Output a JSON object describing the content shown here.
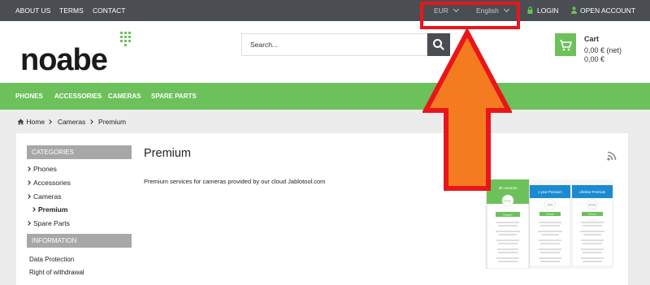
{
  "topbar": {
    "links": [
      "ABOUT US",
      "TERMS",
      "CONTACT"
    ],
    "currency": "EUR",
    "language": "English",
    "login": "LOGIN",
    "open_account": "OPEN ACCOUNT"
  },
  "header": {
    "logo": "noabe",
    "search_placeholder": "Search...",
    "cart_title": "Cart",
    "cart_net": "0,00 € (net)",
    "cart_gross": "0,00 €"
  },
  "nav": {
    "items": [
      "PHONES",
      "ACCESSORIES",
      "CAMERAS",
      "SPARE PARTS"
    ]
  },
  "breadcrumb": [
    "Home",
    "Cameras",
    "Premium"
  ],
  "sidebar": {
    "categories_title": "CATEGORIES",
    "categories": [
      "Phones",
      "Accessories",
      "Cameras",
      "Premium",
      "Spare Parts"
    ],
    "information_title": "INFORMATION",
    "information": [
      "Data Protection",
      "Right of withdrawal"
    ]
  },
  "main": {
    "title": "Premium",
    "description": "Premium services for cameras provided by our cloud Jablotool.com"
  },
  "pricing": {
    "plans": [
      "all cameras",
      "1 year Premium",
      "Lifetime Premium"
    ],
    "prices": [
      "Free",
      "€25",
      "€126"
    ],
    "buttons": [
      "Register",
      "Choose",
      "Choose"
    ]
  },
  "colors": {
    "topbar": "#4a4e52",
    "accent": "#6cc15a",
    "highlight": "#e8161b",
    "arrow": "#f47b20"
  }
}
